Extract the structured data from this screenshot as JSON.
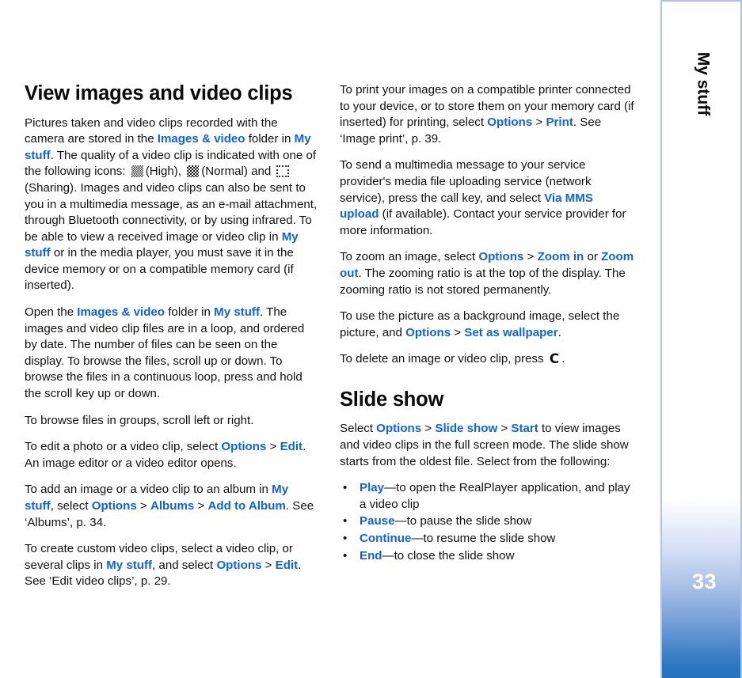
{
  "document": {
    "page_number": "33",
    "sidebar_label": "My stuff",
    "link_color": "#0f63e0",
    "sidebar_accent_color": "#2571be",
    "sidebar_border_color": "#b3c0e6"
  },
  "left_column": {
    "heading": "View images and video clips",
    "paragraph_1": {
      "part_1": "Pictures taken and video clips recorded with the camera are stored in the ",
      "link_1": "Images & video",
      "part_2": " folder in ",
      "link_2": "My stuff",
      "part_3": ". The quality of a video clip is indicated with one of the following icons: ",
      "icon_1_caption": "(High), ",
      "icon_2_caption": "(Normal) and ",
      "part_4": "(Sharing). Images and video clips can also be sent to you in a multimedia message, as an e-mail attachment, through Bluetooth connectivity, or by using infrared. To be able to view a received image or video clip in ",
      "link_3": "My stuff",
      "part_5": " or in the media player, you must save it in the device memory or on a compatible memory card (if inserted)."
    },
    "paragraph_2": {
      "part_1": "Open the ",
      "link_1": "Images & video",
      "part_2": " folder in ",
      "link_2": "My stuff",
      "part_3": ". The images and video clip files are in a loop, and ordered by date. The number of files can be seen on the display. To browse the files, scroll up or down. To browse the files in a continuous loop, press and hold the scroll key up or down."
    },
    "paragraph_3": "To browse files in groups, scroll left or right.",
    "paragraph_4": {
      "part_1": "To edit a photo or a video clip, select ",
      "link_1": "Options",
      "sep_1": " > ",
      "link_2": "Edit",
      "part_2": ". An image editor or a video editor opens."
    },
    "paragraph_5": {
      "part_1": "To add an image or a video clip to an album in ",
      "link_1": "My stuff",
      "part_2": ", select ",
      "link_2": "Options",
      "sep_1": " > ",
      "link_3": "Albums",
      "sep_2": " > ",
      "link_4": "Add to Album",
      "part_3": ". See ‘Albums’, p. 34."
    },
    "paragraph_6": {
      "part_1": "To create custom video clips, select a video clip, or several clips in ",
      "link_1": "My stuff",
      "part_2": ", and select ",
      "link_2": "Options",
      "sep_1": " > ",
      "link_3": "Edit",
      "part_3": ". See ‘Edit video clips’, p. 29."
    }
  },
  "right_column": {
    "paragraph_1": {
      "part_1": "To print your images on a compatible printer connected to your device, or to store them on your memory card (if inserted) for printing, select ",
      "link_1": "Options",
      "sep_1": " > ",
      "link_2": "Print",
      "part_2": ". See ‘Image print’, p. 39."
    },
    "paragraph_2": {
      "part_1": "To send a multimedia message to your service provider's media file uploading service (network service), press the call key, and select ",
      "link_1": "Via MMS upload",
      "part_2": " (if available). Contact your service provider for more information."
    },
    "paragraph_3": {
      "part_1": "To zoom an image, select ",
      "link_1": "Options",
      "sep_1": " > ",
      "link_2": "Zoom in",
      "part_2": " or ",
      "link_3": "Zoom out",
      "part_3": ". The zooming ratio is at the top of the display. The zooming ratio is not stored permanently."
    },
    "paragraph_4": {
      "part_1": "To use the picture as a background image, select the picture, and ",
      "link_1": "Options",
      "sep_1": " > ",
      "link_2": "Set as wallpaper",
      "part_2": "."
    },
    "paragraph_5": {
      "part_1": "To delete an image or video clip, press ",
      "key_glyph": "C",
      "part_2": "."
    },
    "heading": "Slide show",
    "paragraph_6": {
      "part_1": "Select ",
      "link_1": "Options",
      "sep_1": " > ",
      "link_2": "Slide show",
      "sep_2": " > ",
      "link_3": "Start",
      "part_2": " to view images and video clips in the full screen mode. The slide show starts from the oldest file. Select from the following:"
    },
    "bullets": [
      {
        "bullet": "•",
        "term": "Play",
        "description": "—to open the RealPlayer application, and play a video clip"
      },
      {
        "bullet": "•",
        "term": "Pause",
        "description": "—to pause the slide show"
      },
      {
        "bullet": "•",
        "term": "Continue",
        "description": "—to resume the slide show"
      },
      {
        "bullet": "•",
        "term": "End",
        "description": "—to close the slide show"
      }
    ]
  }
}
